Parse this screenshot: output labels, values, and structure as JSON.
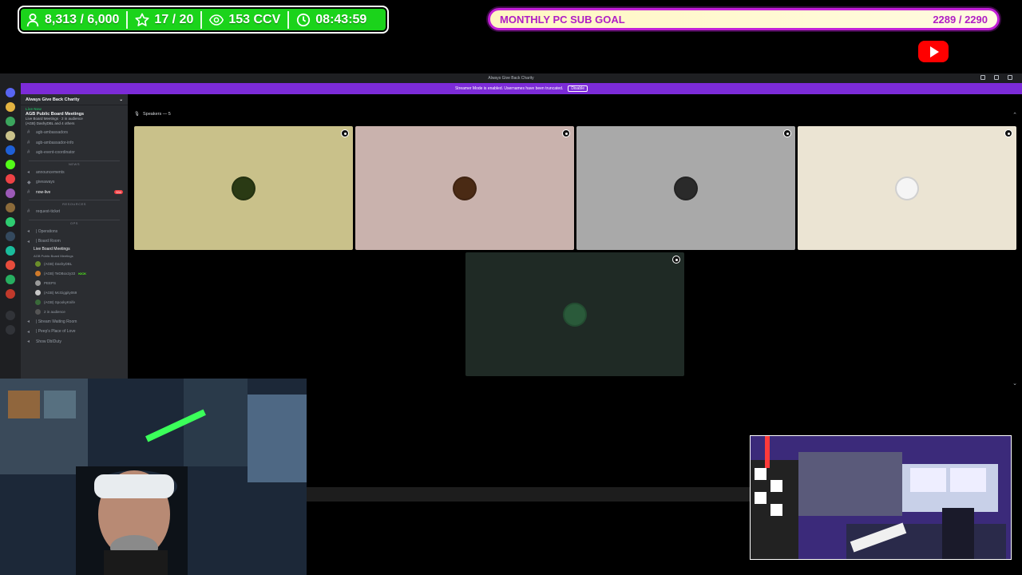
{
  "overlay": {
    "stats": [
      {
        "icon": "person-icon",
        "value": "8,313 / 6,000"
      },
      {
        "icon": "star-icon",
        "value": "17 / 20"
      },
      {
        "icon": "eye-icon",
        "value": "153 CCV"
      },
      {
        "icon": "clock-icon",
        "value": "08:43:59"
      }
    ],
    "goal": {
      "label": "MONTHLY PC SUB GOAL",
      "value": "2289 / 2290",
      "progress": 0.9996
    },
    "youtube_icon": "youtube-icon"
  },
  "window": {
    "title": "Always Give Back Charity",
    "banner": {
      "text": "Streamer Mode is enabled. Usernames have been truncated.",
      "button": "Disable"
    }
  },
  "sidebar": {
    "server_name": "Always Give Back Charity",
    "live": {
      "status": "Live Now",
      "event_title": "AGB Public Board Meetings",
      "detail1": "Live Board Meetings · 2 in audience",
      "detail2": "(AGB) DashyDBL and 4 others"
    },
    "channels_top": [
      {
        "name": "agb-ambassadors",
        "type": "text"
      },
      {
        "name": "agb-ambassador-info",
        "type": "text"
      },
      {
        "name": "agb-event-coordinator",
        "type": "text"
      }
    ],
    "cat_news": "NEWS",
    "channels_news": [
      {
        "name": "announcements",
        "type": "text"
      },
      {
        "name": "giveaways",
        "type": "text"
      },
      {
        "name": "now-live",
        "type": "text",
        "badge": "534"
      }
    ],
    "cat_resources": "RESOURCES",
    "channels_resources": [
      {
        "name": "request-ticket",
        "type": "text"
      }
    ],
    "cat_ops": "OPS",
    "channels_ops": [
      {
        "name": "| Operations",
        "type": "voice"
      },
      {
        "name": "| Board Room",
        "type": "voice"
      },
      {
        "name": "Live Board Meetings",
        "type": "stage",
        "sub": "AGB Public Board Meetings"
      }
    ],
    "stage_users": [
      {
        "name": "(AGB) DashyDBL",
        "color": "#6b8f2a"
      },
      {
        "name": "(AGB) TeDBox2y33",
        "color": "#d07a2a",
        "tag": "KICK"
      },
      {
        "name": "PEEPS",
        "color": "#9a9a9a"
      },
      {
        "name": "(AGB) McGiggity069",
        "color": "#c8c8c8"
      },
      {
        "name": "(AGB) SpookyKnife",
        "color": "#3a6a3a"
      },
      {
        "name": "2 in audience",
        "color": "#555"
      }
    ],
    "channels_bottom": [
      {
        "name": "| Stream Waiting Room",
        "type": "voice"
      },
      {
        "name": "| Peep's Place of Love",
        "type": "voice"
      },
      {
        "name": "Show DbIDuty",
        "type": "voice"
      }
    ]
  },
  "stage": {
    "header": "Speakers — 5",
    "tiles": [
      {
        "bg": "#c9c18a",
        "avatar": "#2a3a14"
      },
      {
        "bg": "#c9b2ad",
        "avatar": "#4a2a14"
      },
      {
        "bg": "#a9a9a9",
        "avatar": "#2a2a2a"
      },
      {
        "bg": "#ebe4d3",
        "avatar": "#f5f5f5"
      },
      {
        "bg": "#1f2a25",
        "avatar": "#2a5a3a"
      }
    ]
  }
}
